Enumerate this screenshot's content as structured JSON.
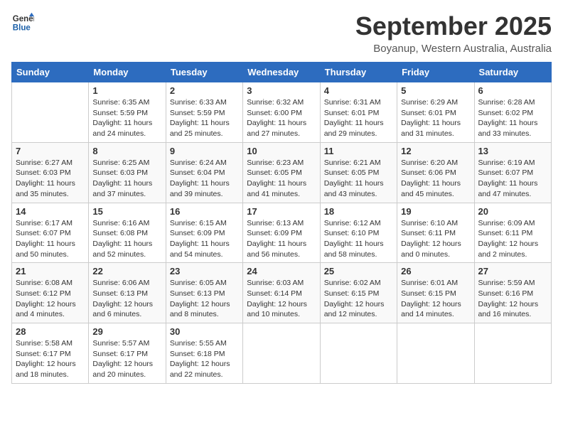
{
  "header": {
    "logo_line1": "General",
    "logo_line2": "Blue",
    "month": "September 2025",
    "location": "Boyanup, Western Australia, Australia"
  },
  "days_of_week": [
    "Sunday",
    "Monday",
    "Tuesday",
    "Wednesday",
    "Thursday",
    "Friday",
    "Saturday"
  ],
  "weeks": [
    [
      {
        "day": "",
        "info": ""
      },
      {
        "day": "1",
        "info": "Sunrise: 6:35 AM\nSunset: 5:59 PM\nDaylight: 11 hours\nand 24 minutes."
      },
      {
        "day": "2",
        "info": "Sunrise: 6:33 AM\nSunset: 5:59 PM\nDaylight: 11 hours\nand 25 minutes."
      },
      {
        "day": "3",
        "info": "Sunrise: 6:32 AM\nSunset: 6:00 PM\nDaylight: 11 hours\nand 27 minutes."
      },
      {
        "day": "4",
        "info": "Sunrise: 6:31 AM\nSunset: 6:01 PM\nDaylight: 11 hours\nand 29 minutes."
      },
      {
        "day": "5",
        "info": "Sunrise: 6:29 AM\nSunset: 6:01 PM\nDaylight: 11 hours\nand 31 minutes."
      },
      {
        "day": "6",
        "info": "Sunrise: 6:28 AM\nSunset: 6:02 PM\nDaylight: 11 hours\nand 33 minutes."
      }
    ],
    [
      {
        "day": "7",
        "info": "Sunrise: 6:27 AM\nSunset: 6:03 PM\nDaylight: 11 hours\nand 35 minutes."
      },
      {
        "day": "8",
        "info": "Sunrise: 6:25 AM\nSunset: 6:03 PM\nDaylight: 11 hours\nand 37 minutes."
      },
      {
        "day": "9",
        "info": "Sunrise: 6:24 AM\nSunset: 6:04 PM\nDaylight: 11 hours\nand 39 minutes."
      },
      {
        "day": "10",
        "info": "Sunrise: 6:23 AM\nSunset: 6:05 PM\nDaylight: 11 hours\nand 41 minutes."
      },
      {
        "day": "11",
        "info": "Sunrise: 6:21 AM\nSunset: 6:05 PM\nDaylight: 11 hours\nand 43 minutes."
      },
      {
        "day": "12",
        "info": "Sunrise: 6:20 AM\nSunset: 6:06 PM\nDaylight: 11 hours\nand 45 minutes."
      },
      {
        "day": "13",
        "info": "Sunrise: 6:19 AM\nSunset: 6:07 PM\nDaylight: 11 hours\nand 47 minutes."
      }
    ],
    [
      {
        "day": "14",
        "info": "Sunrise: 6:17 AM\nSunset: 6:07 PM\nDaylight: 11 hours\nand 50 minutes."
      },
      {
        "day": "15",
        "info": "Sunrise: 6:16 AM\nSunset: 6:08 PM\nDaylight: 11 hours\nand 52 minutes."
      },
      {
        "day": "16",
        "info": "Sunrise: 6:15 AM\nSunset: 6:09 PM\nDaylight: 11 hours\nand 54 minutes."
      },
      {
        "day": "17",
        "info": "Sunrise: 6:13 AM\nSunset: 6:09 PM\nDaylight: 11 hours\nand 56 minutes."
      },
      {
        "day": "18",
        "info": "Sunrise: 6:12 AM\nSunset: 6:10 PM\nDaylight: 11 hours\nand 58 minutes."
      },
      {
        "day": "19",
        "info": "Sunrise: 6:10 AM\nSunset: 6:11 PM\nDaylight: 12 hours\nand 0 minutes."
      },
      {
        "day": "20",
        "info": "Sunrise: 6:09 AM\nSunset: 6:11 PM\nDaylight: 12 hours\nand 2 minutes."
      }
    ],
    [
      {
        "day": "21",
        "info": "Sunrise: 6:08 AM\nSunset: 6:12 PM\nDaylight: 12 hours\nand 4 minutes."
      },
      {
        "day": "22",
        "info": "Sunrise: 6:06 AM\nSunset: 6:13 PM\nDaylight: 12 hours\nand 6 minutes."
      },
      {
        "day": "23",
        "info": "Sunrise: 6:05 AM\nSunset: 6:13 PM\nDaylight: 12 hours\nand 8 minutes."
      },
      {
        "day": "24",
        "info": "Sunrise: 6:03 AM\nSunset: 6:14 PM\nDaylight: 12 hours\nand 10 minutes."
      },
      {
        "day": "25",
        "info": "Sunrise: 6:02 AM\nSunset: 6:15 PM\nDaylight: 12 hours\nand 12 minutes."
      },
      {
        "day": "26",
        "info": "Sunrise: 6:01 AM\nSunset: 6:15 PM\nDaylight: 12 hours\nand 14 minutes."
      },
      {
        "day": "27",
        "info": "Sunrise: 5:59 AM\nSunset: 6:16 PM\nDaylight: 12 hours\nand 16 minutes."
      }
    ],
    [
      {
        "day": "28",
        "info": "Sunrise: 5:58 AM\nSunset: 6:17 PM\nDaylight: 12 hours\nand 18 minutes."
      },
      {
        "day": "29",
        "info": "Sunrise: 5:57 AM\nSunset: 6:17 PM\nDaylight: 12 hours\nand 20 minutes."
      },
      {
        "day": "30",
        "info": "Sunrise: 5:55 AM\nSunset: 6:18 PM\nDaylight: 12 hours\nand 22 minutes."
      },
      {
        "day": "",
        "info": ""
      },
      {
        "day": "",
        "info": ""
      },
      {
        "day": "",
        "info": ""
      },
      {
        "day": "",
        "info": ""
      }
    ]
  ]
}
